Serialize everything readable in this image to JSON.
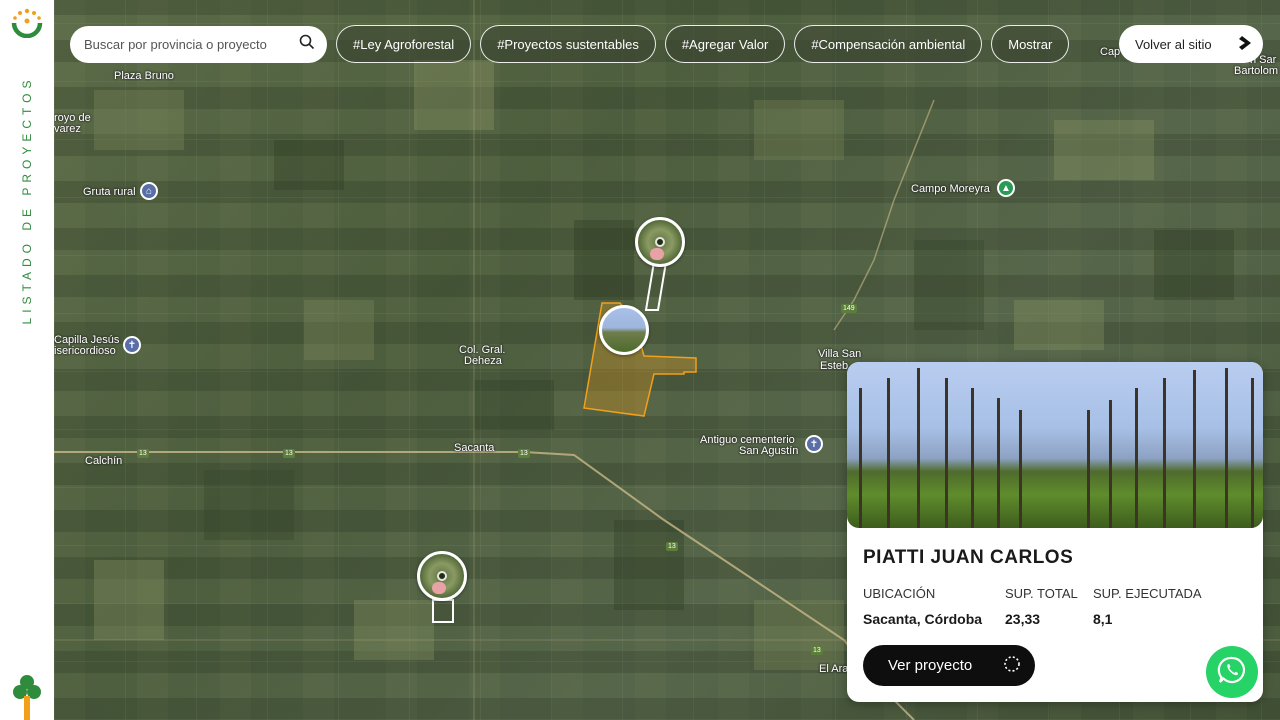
{
  "sidebar": {
    "vertical_label": "LISTADO DE PROYECTOS"
  },
  "search": {
    "placeholder": "Buscar por provincia o proyecto"
  },
  "tags": [
    "#Ley Agroforestal",
    "#Proyectos sustentables",
    "#Agregar Valor",
    "#Compensación ambiental",
    "Mostrar"
  ],
  "back_button": {
    "label": "Volver al sitio"
  },
  "map": {
    "places": {
      "plaza_bruno": "Plaza Bruno",
      "arroyo_1": "royo de",
      "arroyo_2": "varez",
      "gruta_rural": "Gruta rural",
      "campo_moreyra": "Campo Moreyra",
      "capilla_1": "Capilla Jesús",
      "capilla_2": "isericordioso",
      "col_gral_1": "Col. Gral.",
      "col_gral_2": "Deheza",
      "villa_san_1": "Villa San",
      "villa_san_2": "Esteb",
      "calchin": "Calchín",
      "sacanta": "Sacanta",
      "cementerio_1": "Antiguo cementerio",
      "cementerio_2": "San Agustín",
      "el_ara": "El Ara",
      "cap": "Cap",
      "san_bartolo_1": "n Sar",
      "san_bartolo_2": "Bartolom"
    },
    "roads": {
      "r13a": "13",
      "r13b": "13",
      "r13c": "13",
      "r13d": "13",
      "r13e": "13",
      "r149": "149"
    }
  },
  "card": {
    "title": "PIATTI JUAN CARLOS",
    "ubicacion_label": "UBICACIÓN",
    "sup_total_label": "SUP. TOTAL",
    "sup_ejecutada_label": "SUP. EJECUTADA",
    "ubicacion_value": "Sacanta, Córdoba",
    "sup_total_value": "23,33",
    "sup_ejecutada_value": "8,1",
    "button_label": "Ver proyecto"
  },
  "colors": {
    "brand_green": "#2f8c3c",
    "highlight_orange": "#f2a01c",
    "whatsapp_green": "#25d366"
  },
  "icons": [
    "logo-icon",
    "search-icon",
    "arrow-right-icon",
    "tree-icon",
    "loader-icon",
    "whatsapp-icon",
    "church-icon",
    "park-icon",
    "cemetery-icon"
  ]
}
